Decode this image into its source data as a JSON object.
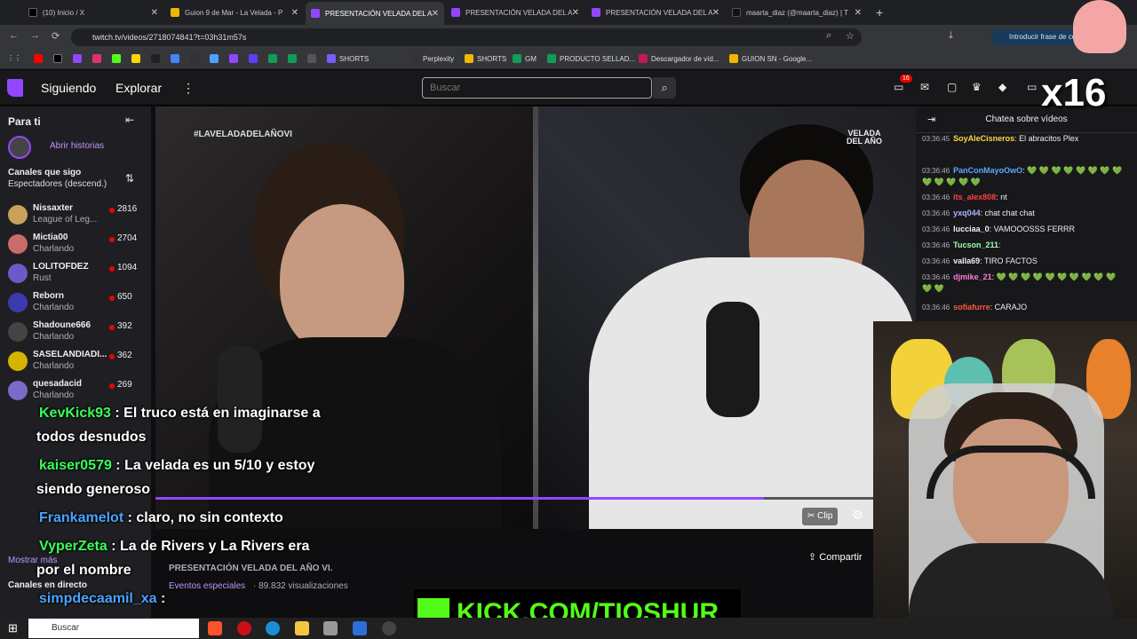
{
  "browser": {
    "tabs": [
      {
        "title": "(10) Inicio / X",
        "fav": "#000000"
      },
      {
        "title": "Guion 9 de Mar - La Velada - P",
        "fav": "#f2b600"
      },
      {
        "title": "PRESENTACIÓN VELADA DEL A",
        "fav": "#9147ff",
        "active": true
      },
      {
        "title": "PRESENTACIÓN VELADA DEL A",
        "fav": "#9147ff"
      },
      {
        "title": "PRESENTACIÓN VELADA DEL A",
        "fav": "#9147ff"
      },
      {
        "title": "maarta_diaz (@maarta_diaz) | T",
        "fav": "#111111"
      }
    ],
    "url": "twitch.tv/videos/2718074841?t=03h31m57s",
    "translate_hint": "Introducir frase de contr",
    "bookmarks": [
      "SHORTS",
      "Perplexity",
      "SHORTS",
      "GM",
      "PRODUCTO SELLAD...",
      "Descargador de víd...",
      "GUION SN - Google..."
    ]
  },
  "twitch": {
    "nav": {
      "following": "Siguiendo",
      "browse": "Explorar",
      "more": "⋮"
    },
    "search_placeholder": "Buscar",
    "notif_count": "16",
    "sidebar": {
      "for_you": "Para ti",
      "open_stories": "Abrir historias",
      "followed_header": "Canales que sigo",
      "sort_label": "Espectadores (descend.)",
      "show_more": "Mostrar más",
      "live_header": "Canales en directo",
      "channels": [
        {
          "name": "Nissaxter",
          "game": "League of Leg...",
          "viewers": "2816",
          "color": "#c9a15b"
        },
        {
          "name": "Mictia00",
          "game": "Charlando",
          "viewers": "2704",
          "color": "#c96b6b"
        },
        {
          "name": "LOLITOFDEZ",
          "game": "Rust",
          "viewers": "1094",
          "color": "#6b5bc9"
        },
        {
          "name": "Reborn",
          "game": "Charlando",
          "viewers": "650",
          "color": "#3b3bb0"
        },
        {
          "name": "Shadoune666",
          "game": "Charlando",
          "viewers": "392",
          "color": "#444444"
        },
        {
          "name": "SASELANDIADI...",
          "game": "Charlando",
          "viewers": "362",
          "color": "#d4b400"
        },
        {
          "name": "quesadacid",
          "game": "Charlando",
          "viewers": "269",
          "color": "#7a6bc9"
        }
      ]
    },
    "video": {
      "hashtag": "#LAVELADADELAÑOVI",
      "corner_logo_1": "VELADA",
      "corner_logo_2": "DEL AÑO",
      "clip": "Clip",
      "share": "Compartir",
      "title": "PRESENTACIÓN VELADA DEL AÑO VI.",
      "category": "Eventos especiales",
      "views": " · 89.832 visualizaciones",
      "progress": 0.8
    },
    "chat": {
      "header": "Chatea sobre vídeos",
      "messages": [
        {
          "ts": "03:36:45",
          "user": "SoyAleCisneros",
          "color": "#ffd84a",
          "text": ": El abracitos Plex"
        },
        {
          "ts": "03:36:46",
          "user": "PanConMayoOwO",
          "color": "#5aa9ff",
          "text": ": 💚 💚 💚 💚 💚 💚 💚 💚 💚 💚 💚 💚 💚"
        },
        {
          "ts": "03:36:46",
          "user": "its_alex808",
          "color": "#ff4040",
          "text": ": nt"
        },
        {
          "ts": "03:36:46",
          "user": "yxq044",
          "color": "#aab4ff",
          "text": ": chat chat chat"
        },
        {
          "ts": "03:36:46",
          "user": "lucciaa_0",
          "color": "#efeff1",
          "text": ": VAMOOOSSS FERRR"
        },
        {
          "ts": "03:36:46",
          "user": "Tucson_211",
          "color": "#9bffb0",
          "text": ":"
        },
        {
          "ts": "03:36:46",
          "user": "valla69",
          "color": "#efeff1",
          "text": ": TIRO FACTOS"
        },
        {
          "ts": "03:36:46",
          "user": "djmike_21",
          "color": "#ff7bd8",
          "text": ": 💚 💚 💚 💚 💚 💚 💚 💚 💚 💚 💚 💚"
        },
        {
          "ts": "03:36:46",
          "user": "sofiafurre",
          "color": "#ff5a3c",
          "text": ": CARAJO"
        }
      ]
    }
  },
  "overlay_chat": [
    {
      "user": "KevKick93",
      "text": " : El truco está en imaginarse a",
      "cont": "todos desnudos"
    },
    {
      "user": "kaiser0579",
      "text": " : La velada es un 5/10 y estoy",
      "cont": "siendo generoso"
    },
    {
      "user": "Frankamelot",
      "text": " : claro, no sin contexto",
      "cont": ""
    },
    {
      "user": "VyperZeta",
      "text": " : La de Rivers y La Rivers era",
      "cont": "por el nombre"
    },
    {
      "user": "simpdecaamil_xa",
      "text": " :",
      "cont": ""
    }
  ],
  "kick_banner": "KICK.COM/TIOSHUR",
  "sticker_text": "x16",
  "taskbar": {
    "search": "Buscar"
  }
}
